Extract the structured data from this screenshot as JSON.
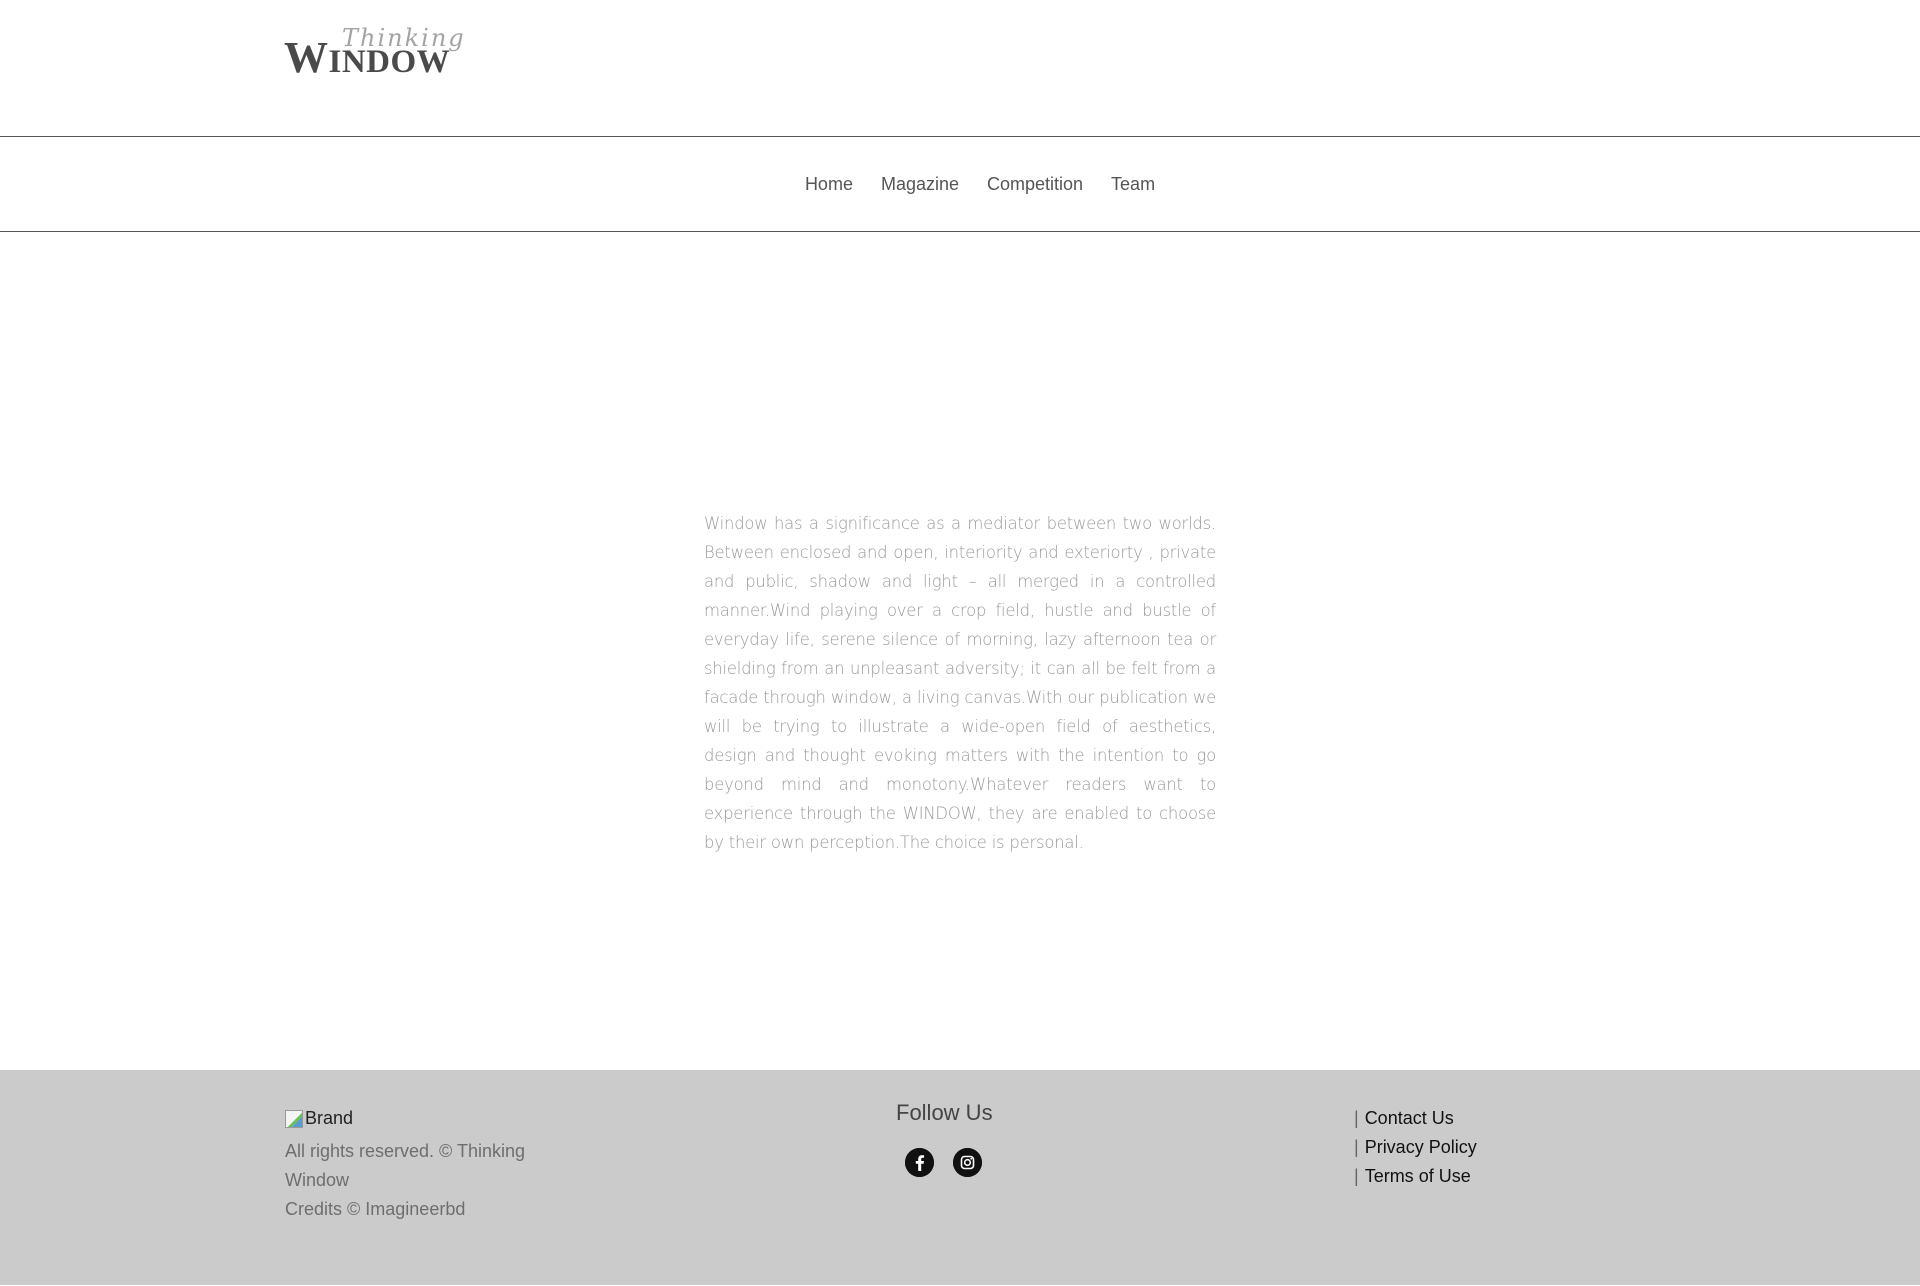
{
  "header": {
    "logo_main": "WINDOW",
    "logo_script": "Thinking"
  },
  "nav": {
    "items": [
      "Home",
      "Magazine",
      "Competition",
      "Team"
    ]
  },
  "main": {
    "intro": "Window has a significance as a mediator between two worlds. Between enclosed and open, interiority and exteriorty , private and public, shadow and light – all merged in a controlled manner.Wind playing over a crop field, hustle and bustle of everyday life, serene silence of morning, lazy afternoon tea or shielding from an unpleasant adversity; it can all be felt from a facade through window, a living canvas.With our publication we will be trying to illustrate a wide-open field of aesthetics, design and thought evoking matters with the intention to go beyond mind and monotony.Whatever readers want to experience through the WINDOW, they are enabled to choose by their own perception.The choice is personal."
  },
  "footer": {
    "brand_alt": "Brand",
    "rights": "All rights reserved.   © Thinking Window",
    "credits": "Credits © Imagineerbd",
    "follow_title": "Follow Us",
    "social": [
      {
        "icon": "facebook-icon",
        "glyph": "f"
      },
      {
        "icon": "instagram-icon",
        "glyph": "◎"
      }
    ],
    "links": [
      "Contact Us",
      "Privacy Policy",
      "Terms of Use"
    ],
    "link_separator": "|"
  },
  "colors": {
    "footer_bg": "#cbcbcb",
    "text_muted": "#9a9a9a",
    "divider": "#555555"
  }
}
